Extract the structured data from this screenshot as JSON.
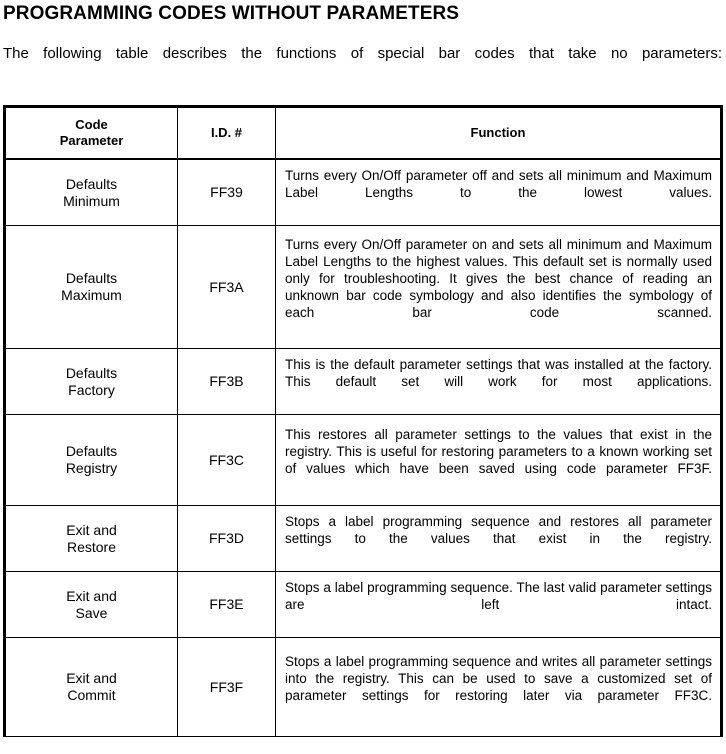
{
  "document": {
    "title": "PROGRAMMING CODES WITHOUT PARAMETERS",
    "intro": "The following table describes the functions of special bar codes that take no parameters:"
  },
  "table": {
    "headers": {
      "code_parameter_line1": "Code",
      "code_parameter_line2": "Parameter",
      "id": "I.D. #",
      "function": "Function"
    },
    "rows": [
      {
        "param_line1": "Defaults",
        "param_line2": "Minimum",
        "id": "FF39",
        "function": "Turns every On/Off parameter off and sets all minimum and Maximum Label Lengths to the lowest values."
      },
      {
        "param_line1": "Defaults",
        "param_line2": "Maximum",
        "id": "FF3A",
        "function": "Turns every On/Off parameter on and sets all minimum and Maximum Label Lengths to the highest values. This default set is normally used only for troubleshooting. It gives the best chance of reading an unknown bar code symbology and also identifies the symbology of each bar code scanned."
      },
      {
        "param_line1": "Defaults",
        "param_line2": "Factory",
        "id": "FF3B",
        "function": "This is the default parameter settings that was installed at the factory. This default set will work for most applications."
      },
      {
        "param_line1": "Defaults",
        "param_line2": "Registry",
        "id": "FF3C",
        "function": "This restores all parameter settings to the values that exist in the registry. This is useful for restoring parameters to a known working set of values which have been saved using code parameter FF3F."
      },
      {
        "param_line1": "Exit and",
        "param_line2": "Restore",
        "id": "FF3D",
        "function": "Stops a label programming sequence and restores all parameter settings to the values that exist in the registry."
      },
      {
        "param_line1": "Exit and",
        "param_line2": "Save",
        "id": "FF3E",
        "function": "Stops a label programming sequence. The last valid parameter settings are left intact."
      },
      {
        "param_line1": "Exit and",
        "param_line2": "Commit",
        "id": "FF3F",
        "function": "Stops a label programming sequence and writes all parameter settings into the registry. This can be used to save a customized set of parameter settings for restoring later via parameter FF3C."
      }
    ]
  }
}
